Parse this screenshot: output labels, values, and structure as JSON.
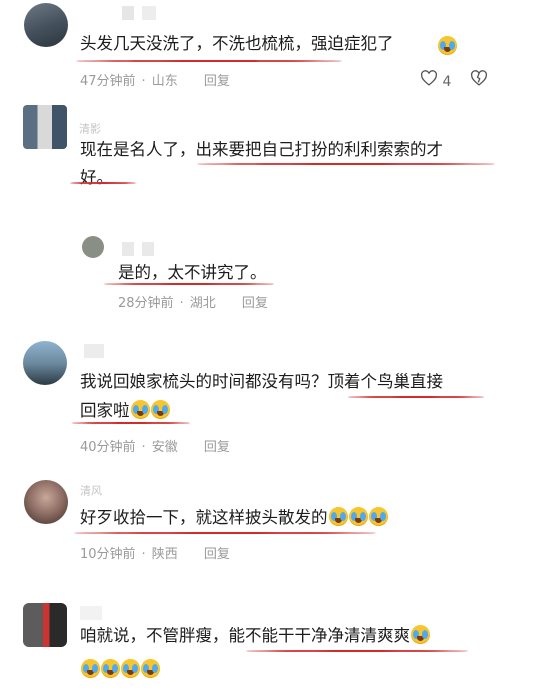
{
  "colors": {
    "underline": "#d22b2b",
    "meta": "#9a9a9a",
    "emoji": "#f7c52d"
  },
  "comments": [
    {
      "text": "头发几天没洗了，不洗也梳梳，强迫症犯了",
      "time": "47分钟前",
      "location": "山东",
      "reply": "回复",
      "like_count": "4"
    },
    {
      "name": "清影",
      "text_line1": "现在是名人了，出来要把自己打扮的利利索索的才",
      "text_line2": "好。"
    },
    {
      "text": "是的，太不讲究了。",
      "time": "28分钟前",
      "location": "湖北",
      "reply": "回复"
    },
    {
      "text_line1": "我说回娘家梳头的时间都没有吗？顶着个鸟巢直接",
      "text_line2": "回家啦",
      "time": "40分钟前",
      "location": "安徽",
      "reply": "回复"
    },
    {
      "name": "清风",
      "text": "好歹收拾一下，就这样披头散发的",
      "time": "10分钟前",
      "location": "陕西",
      "reply": "回复"
    },
    {
      "text": "咱就说，不管胖瘦，能不能干干净净清清爽爽"
    }
  ],
  "icons": {
    "like": "heart-outline-icon",
    "dislike": "broken-heart-icon",
    "emoji": "laugh-cry-emoji"
  }
}
